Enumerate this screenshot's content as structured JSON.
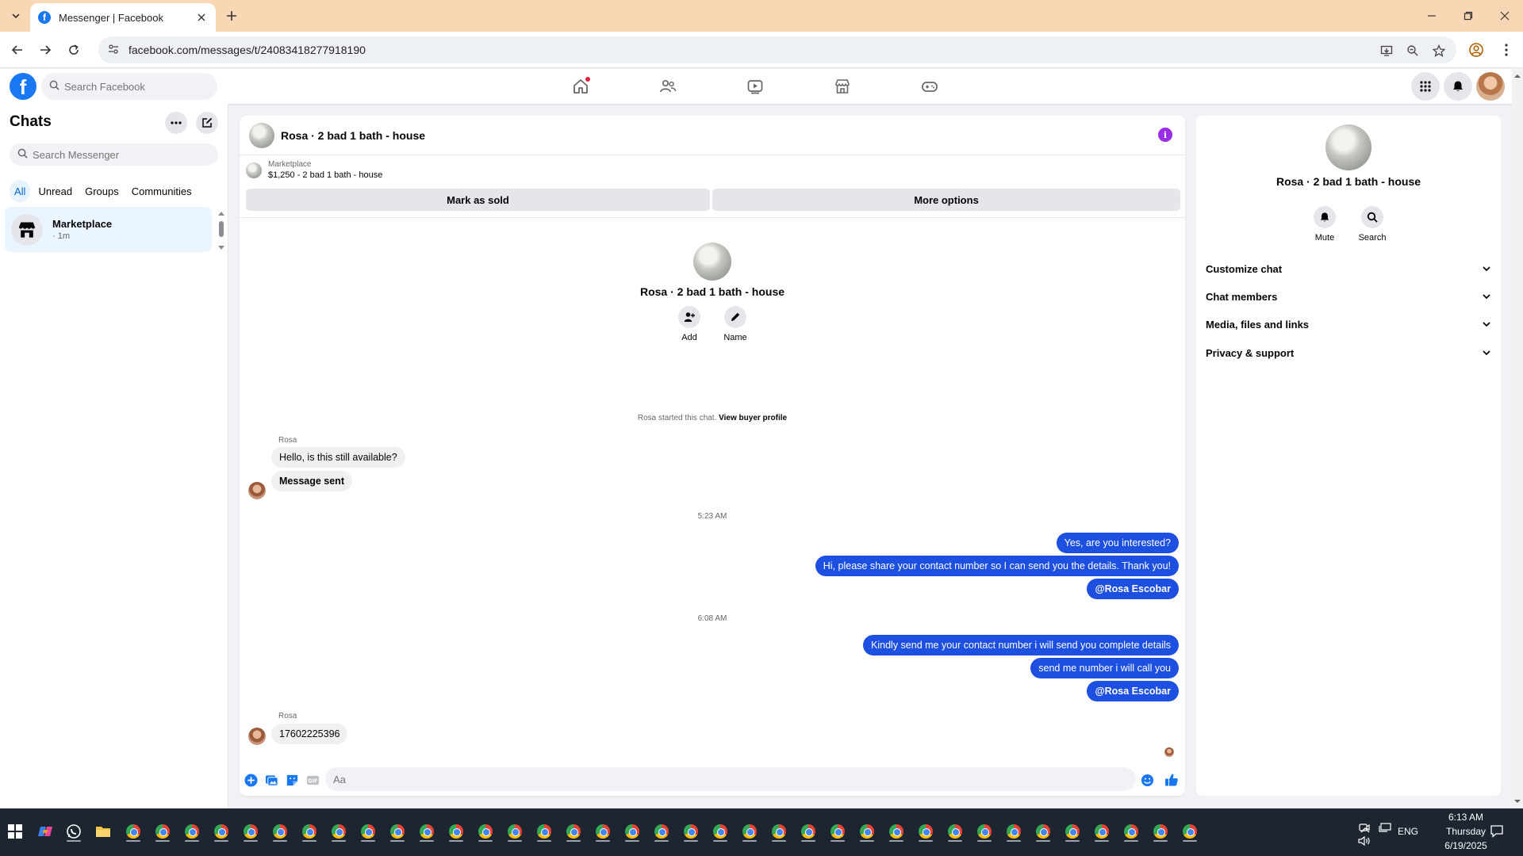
{
  "browser": {
    "tab_title": "Messenger | Facebook",
    "url": "facebook.com/messages/t/24083418277918190"
  },
  "fb_header": {
    "logo": "f",
    "search_placeholder": "Search Facebook"
  },
  "sidebar": {
    "title": "Chats",
    "search_placeholder": "Search Messenger",
    "filters": [
      "All",
      "Unread",
      "Groups",
      "Communities"
    ],
    "chats": [
      {
        "name": "Marketplace",
        "time": "· 1m"
      }
    ]
  },
  "conversation": {
    "title": "Rosa · 2 bad 1 bath - house",
    "listing_source": "Marketplace",
    "listing_price": "$1,250 - 2 bad 1 bath - house",
    "mark_sold": "Mark as sold",
    "more_options": "More options",
    "center_name": "Rosa · 2 bad 1 bath - house",
    "add_label": "Add",
    "name_label": "Name",
    "started_text": "Rosa started this chat.",
    "view_profile": "View buyer profile",
    "messages": {
      "sender1": "Rosa",
      "in1": "Hello, is this still available?",
      "in2": "Message sent",
      "time1": "5:23 AM",
      "out1": "Yes, are you interested?",
      "out2": "Hi, please share your contact number so I can send you the details. Thank you!",
      "out3": "@Rosa Escobar",
      "time2": "6:08 AM",
      "out4": "Kindly send me your contact number i will send you complete details",
      "out5": "send me number i will call you",
      "out6": "@Rosa Escobar",
      "sender2": "Rosa",
      "in3": "17602225396"
    },
    "composer_placeholder": "Aa"
  },
  "right_panel": {
    "name": "Rosa · 2 bad 1 bath - house",
    "mute_label": "Mute",
    "search_label": "Search",
    "sections": [
      "Customize chat",
      "Chat members",
      "Media, files and links",
      "Privacy & support"
    ]
  },
  "taskbar": {
    "time": "6:13 AM",
    "day": "Thursday",
    "date": "6/19/2025",
    "lang": "ENG"
  },
  "colors": {
    "fb_blue": "#1877f2",
    "outgoing_bubble": "#1d4fe0",
    "tab_strip": "#f9d7b5"
  }
}
